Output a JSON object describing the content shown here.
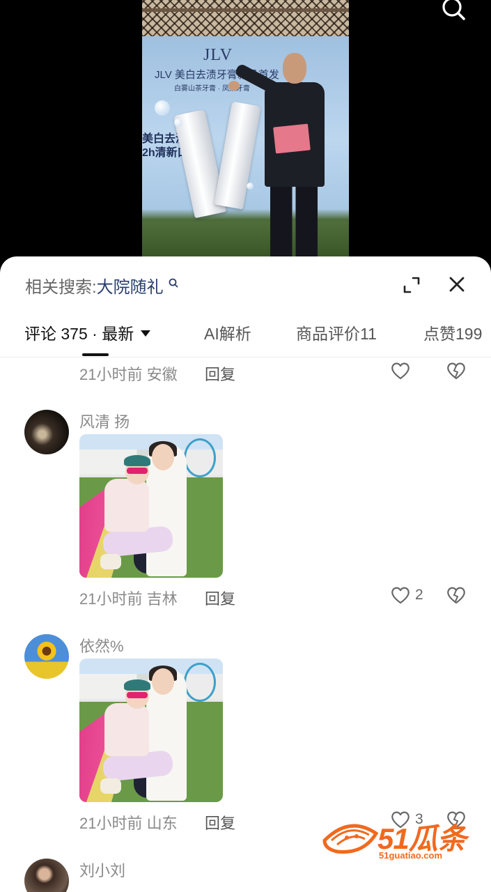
{
  "video": {
    "banner_brand": "JLV",
    "banner_title": "JLV 美白去渍牙膏新品首发",
    "banner_subtitle": "白雾山茶牙膏 · 凤梨牙膏",
    "banner_slogan": "美白去渍\n2h清新口气"
  },
  "comment_panel": {
    "related_search_label": "相关搜索:",
    "related_search_term": "大院随礼",
    "tabs": [
      {
        "label": "评论 375 · 最新"
      },
      {
        "label": "AI解析"
      },
      {
        "label": "商品评价11"
      },
      {
        "label": "点赞199"
      }
    ],
    "reply_label": "回复",
    "comments": [
      {
        "time": "21小时前",
        "location": "安徽",
        "likes": ""
      },
      {
        "username": "风清 扬",
        "time": "21小时前",
        "location": "吉林",
        "likes": "2"
      },
      {
        "username": "依然%",
        "time": "21小时前",
        "location": "山东",
        "likes": "3"
      },
      {
        "username": "刘小刘"
      }
    ]
  },
  "watermark": {
    "brand": "51瓜条",
    "url": "51guatiao.com"
  },
  "colors": {
    "accent_orange": "#f06a1e",
    "related_term_blue": "#2a3e6e",
    "secondary_text": "#8a8a8a"
  }
}
